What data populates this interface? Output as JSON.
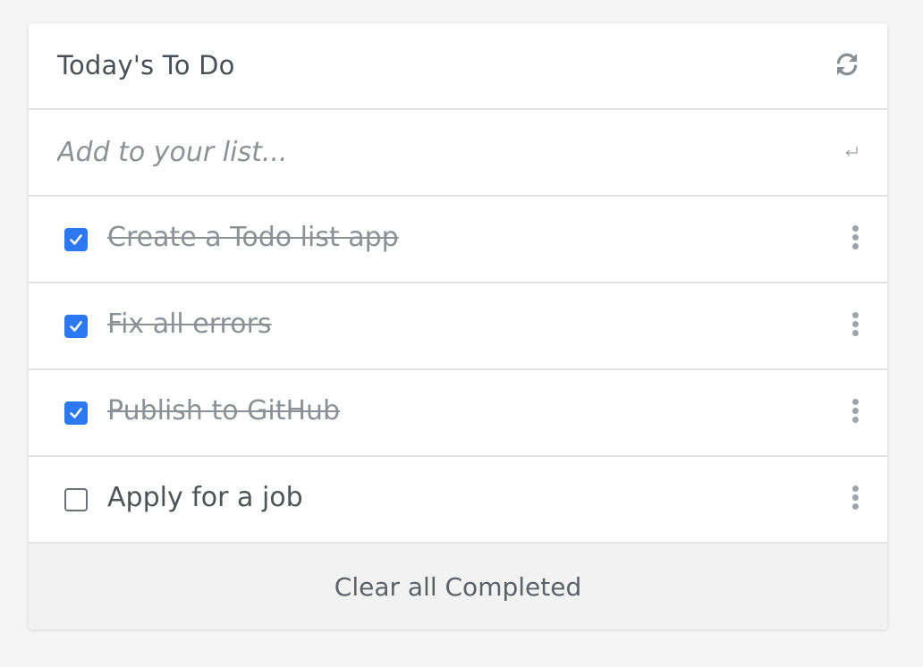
{
  "header": {
    "title": "Today's To Do",
    "refresh_icon": "refresh-icon"
  },
  "add_input": {
    "placeholder": "Add to your list...",
    "value": "",
    "enter_icon": "enter-return-icon"
  },
  "todos": [
    {
      "text": "Create a Todo list app",
      "completed": true
    },
    {
      "text": "Fix all errors",
      "completed": true
    },
    {
      "text": "Publish to GitHub",
      "completed": true
    },
    {
      "text": "Apply for a job",
      "completed": false
    }
  ],
  "footer": {
    "clear_label": "Clear all Completed"
  },
  "colors": {
    "accent": "#2b78f1",
    "background": "#f5f5f5",
    "card": "#ffffff",
    "footer": "#f2f2f2"
  }
}
